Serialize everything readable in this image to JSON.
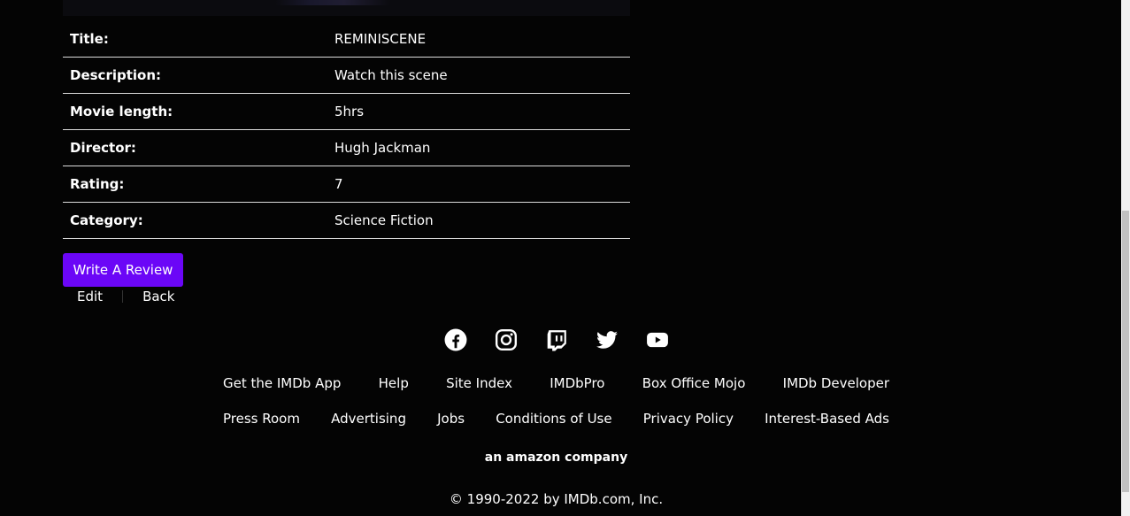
{
  "details": [
    {
      "label": "Title:",
      "value": "REMINISCENE"
    },
    {
      "label": "Description:",
      "value": "Watch this scene"
    },
    {
      "label": "Movie length:",
      "value": "5hrs"
    },
    {
      "label": "Director:",
      "value": "Hugh Jackman"
    },
    {
      "label": "Rating:",
      "value": "7"
    },
    {
      "label": "Category:",
      "value": "Science Fiction"
    }
  ],
  "actions": {
    "review_label": "Write A Review",
    "edit_label": "Edit",
    "back_label": "Back"
  },
  "footer": {
    "social_icons": [
      "facebook-icon",
      "instagram-icon",
      "twitch-icon",
      "twitter-icon",
      "youtube-icon"
    ],
    "row1": [
      "Get the IMDb App",
      "Help",
      "Site Index",
      "IMDbPro",
      "Box Office Mojo",
      "IMDb Developer"
    ],
    "row2": [
      "Press Room",
      "Advertising",
      "Jobs",
      "Conditions of Use",
      "Privacy Policy",
      "Interest-Based Ads"
    ],
    "company": "an amazon company",
    "copyright": "© 1990-2022 by IMDb.com, Inc."
  },
  "colors": {
    "background": "#040404",
    "accent_button": "#6b06f7",
    "text": "#ffffff"
  }
}
